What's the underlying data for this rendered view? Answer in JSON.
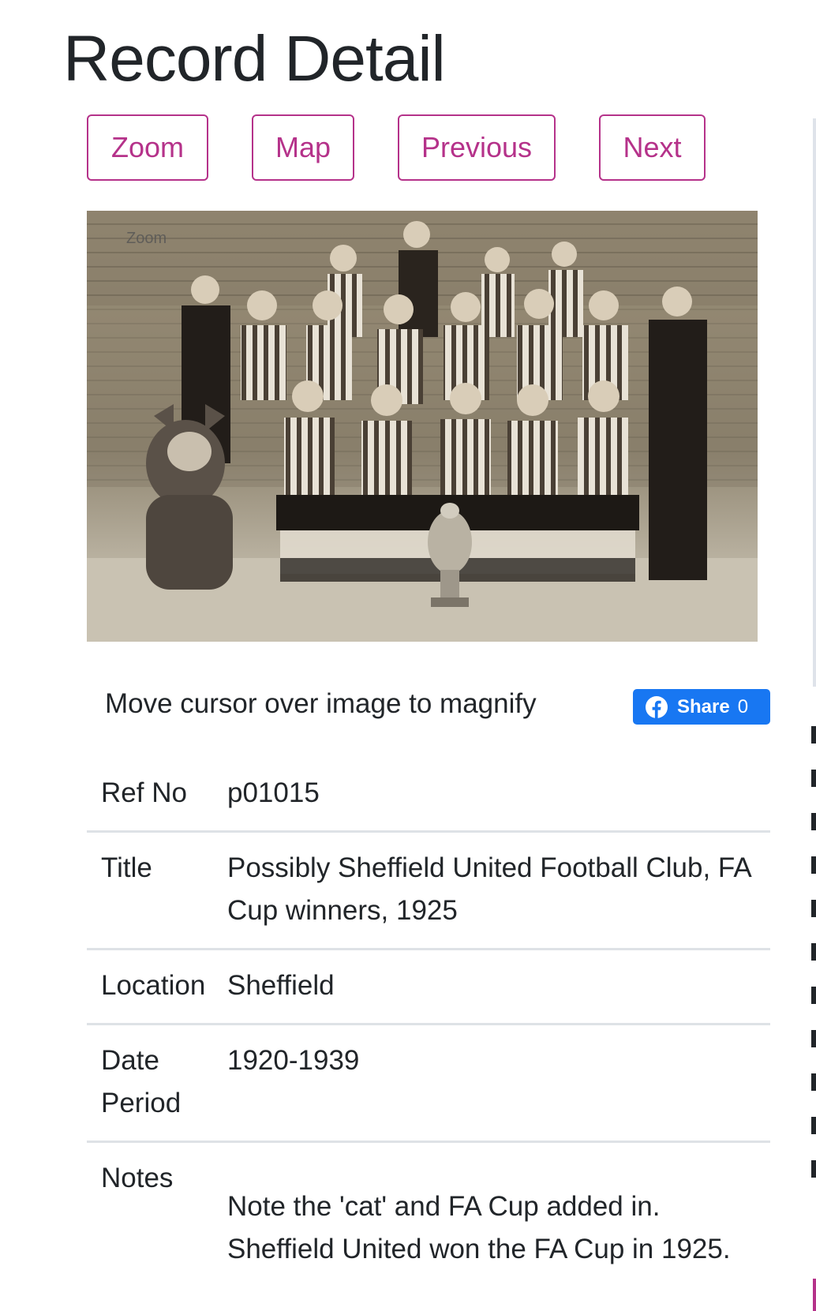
{
  "page": {
    "heading": "Record Detail"
  },
  "toolbar": {
    "zoom_label": "Zoom",
    "map_label": "Map",
    "previous_label": "Previous",
    "next_label": "Next"
  },
  "image": {
    "zoom_hint": "Zoom",
    "magnify_text": "Move cursor over image to magnify"
  },
  "share": {
    "label": "Share",
    "count": "0",
    "icon": "facebook-icon",
    "color": "#1877f2"
  },
  "details": {
    "rows": [
      {
        "label": "Ref No",
        "value": "p01015"
      },
      {
        "label": "Title",
        "value": "Possibly Sheffield United Football Club, FA Cup winners, 1925"
      },
      {
        "label": "Location",
        "value": "Sheffield"
      },
      {
        "label": "Date Period",
        "value": "1920-1939"
      },
      {
        "label": "Notes",
        "value": "Note the 'cat' and FA Cup added in. Sheffield United won the FA Cup in 1925."
      }
    ]
  },
  "colors": {
    "accent": "#b5328a",
    "text": "#212529",
    "divider": "#dee2e6"
  }
}
